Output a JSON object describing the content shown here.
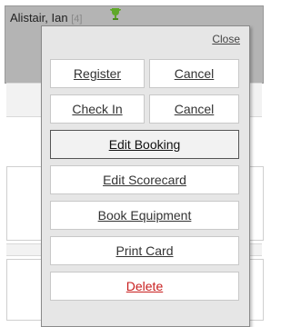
{
  "booking": {
    "player_name": "Alistair, Ian",
    "player_count": "[4]",
    "trophy_icon": "trophy-icon"
  },
  "popup": {
    "close_label": "Close",
    "register_label": "Register",
    "register_cancel_label": "Cancel",
    "checkin_label": "Check In",
    "checkin_cancel_label": "Cancel",
    "edit_booking_label": "Edit Booking",
    "edit_scorecard_label": "Edit Scorecard",
    "book_equipment_label": "Book Equipment",
    "print_card_label": "Print Card",
    "delete_label": "Delete"
  },
  "colors": {
    "card_bg": "#b4b4b4",
    "popup_bg": "#e6e6e6",
    "delete": "#c81e1e",
    "trophy": "#5fa829"
  }
}
